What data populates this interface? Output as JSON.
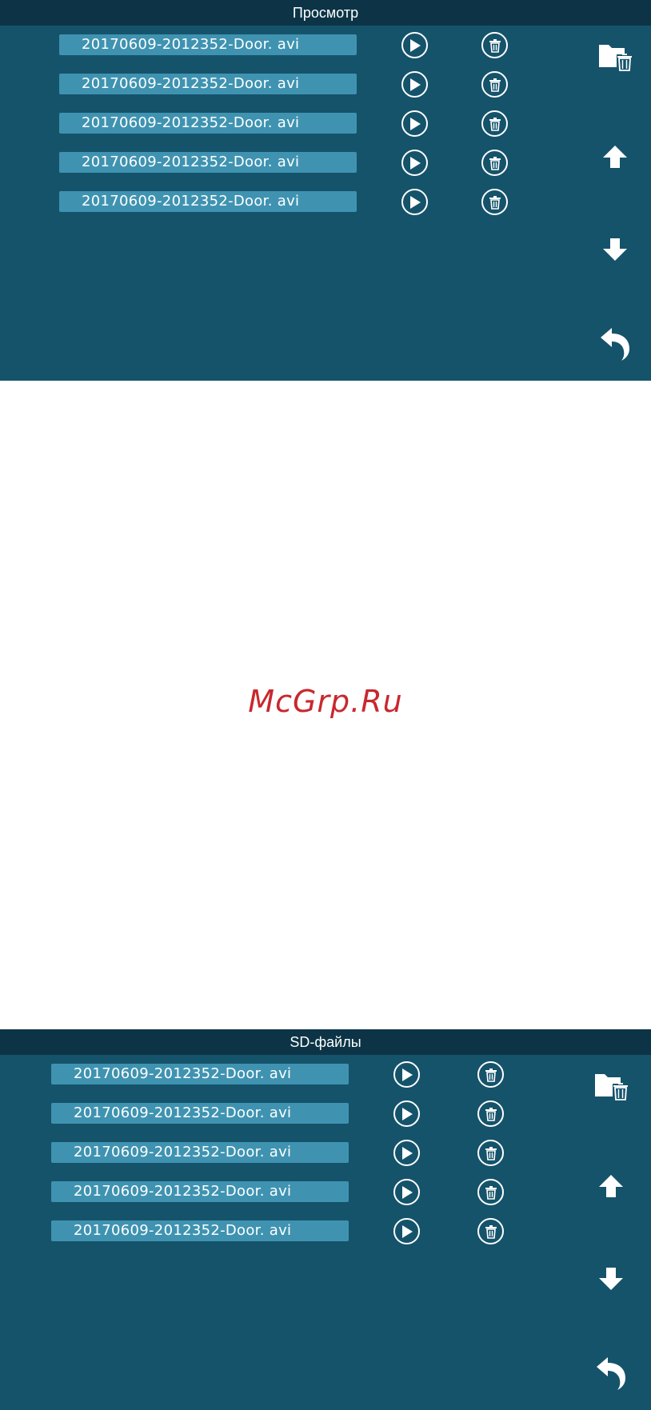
{
  "panels": [
    {
      "title": "Просмотр",
      "files": [
        {
          "name": "20170609-2012352-Door. avi"
        },
        {
          "name": "20170609-2012352-Door. avi"
        },
        {
          "name": "20170609-2012352-Door. avi"
        },
        {
          "name": "20170609-2012352-Door. avi"
        },
        {
          "name": "20170609-2012352-Door. avi"
        }
      ]
    },
    {
      "title": "SD-файлы",
      "files": [
        {
          "name": "20170609-2012352-Door. avi"
        },
        {
          "name": "20170609-2012352-Door. avi"
        },
        {
          "name": "20170609-2012352-Door. avi"
        },
        {
          "name": "20170609-2012352-Door. avi"
        },
        {
          "name": "20170609-2012352-Door. avi"
        }
      ]
    }
  ],
  "watermark": "McGrp.Ru",
  "icons": {
    "play": "play-icon",
    "delete": "trash-icon",
    "delete_all": "folder-delete-icon",
    "up": "arrow-up-icon",
    "down": "arrow-down-icon",
    "back": "back-icon"
  },
  "colors": {
    "panel_bg": "#15536b",
    "header_bg": "#0c3446",
    "file_bar": "#3f93b1",
    "watermark": "#c8282e"
  }
}
